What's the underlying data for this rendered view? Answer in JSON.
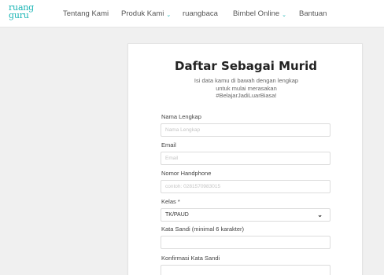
{
  "header": {
    "logo_line1": "ruang",
    "logo_line2": "guru",
    "nav": [
      {
        "label": "Tentang Kami"
      },
      {
        "label": "Produk Kami",
        "chevron": "⌄"
      },
      {
        "label": "ruangbaca"
      },
      {
        "label": "Bimbel Online",
        "chevron": "⌄"
      },
      {
        "label": "Bantuan"
      }
    ]
  },
  "form": {
    "title": "Daftar Sebagai Murid",
    "subtitle": [
      "Isi data kamu di bawah dengan lengkap",
      "untuk mulai merasakan",
      "#BelajarJadiLuarBiasa!"
    ],
    "fields": {
      "nama": {
        "label": "Nama Lengkap",
        "placeholder": "Nama Lengkap"
      },
      "email": {
        "label": "Email",
        "placeholder": "Email"
      },
      "phone": {
        "label": "Nomor Handphone",
        "placeholder": "contoh: 0281570983015"
      },
      "kelas": {
        "label": "Kelas *",
        "value": "TK/PAUD",
        "caret": "⌄"
      },
      "sandi": {
        "label": "Kata Sandi (minimal 6 karakter)",
        "placeholder": ""
      },
      "konfirmasi": {
        "label": "Konfirmasi Kata Sandi",
        "placeholder": ""
      }
    }
  },
  "colors": {
    "brand": "#1bb5b5",
    "background": "#f0f0f0"
  }
}
